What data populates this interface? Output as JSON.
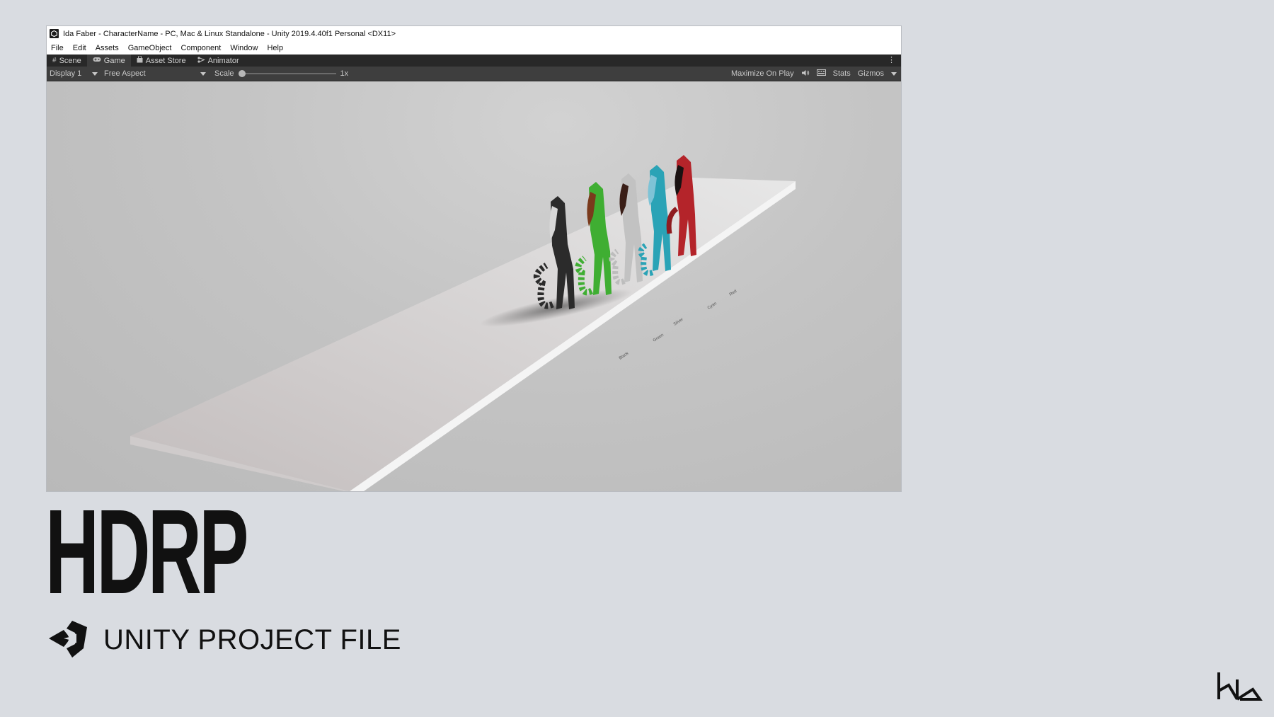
{
  "window": {
    "title": "Ida Faber - CharacterName - PC, Mac & Linux Standalone - Unity 2019.4.40f1 Personal <DX11>",
    "icon": "unity-app-icon"
  },
  "menu": [
    "File",
    "Edit",
    "Assets",
    "GameObject",
    "Component",
    "Window",
    "Help"
  ],
  "tabs": [
    {
      "label": "Scene",
      "icon": "grid-icon",
      "active": false
    },
    {
      "label": "Game",
      "icon": "gamepad-icon",
      "active": true
    },
    {
      "label": "Asset Store",
      "icon": "bag-icon",
      "active": false
    },
    {
      "label": "Animator",
      "icon": "animator-icon",
      "active": false
    }
  ],
  "toolbar": {
    "display": "Display 1",
    "aspect": "Free Aspect",
    "scale_label": "Scale",
    "scale_value": "1x",
    "maximize": "Maximize On Play",
    "stats": "Stats",
    "gizmos": "Gizmos"
  },
  "scene": {
    "name_labels": [
      "Black",
      "Green",
      "Silver",
      "Cyan",
      "Red"
    ],
    "character_colors": [
      "#2b2b2b",
      "#3fae32",
      "#bdbdbd",
      "#2aa3b6",
      "#b4242a"
    ],
    "hair_colors": [
      "#d8d8d8",
      "#7a3a1c",
      "#3a1e17",
      "#7ec3d6",
      "#1a1212"
    ]
  },
  "branding": {
    "headline": "HDRP",
    "subtitle": "UNITY PROJECT FILE",
    "corner_logo": "ida-logo"
  }
}
